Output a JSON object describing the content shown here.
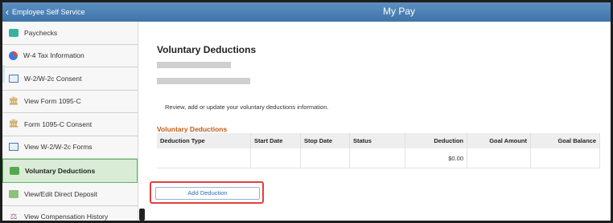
{
  "header": {
    "back_label": "Employee Self Service",
    "title": "My Pay"
  },
  "sidebar": {
    "items": [
      {
        "label": "Paychecks",
        "icon": "paychecks-icon"
      },
      {
        "label": "W-4 Tax Information",
        "icon": "w4-tax-icon"
      },
      {
        "label": "W-2/W-2c Consent",
        "icon": "form-icon"
      },
      {
        "label": "View Form 1095-C",
        "icon": "bank-icon"
      },
      {
        "label": "Form 1095-C Consent",
        "icon": "bank-icon"
      },
      {
        "label": "View W-2/W-2c Forms",
        "icon": "form-icon"
      },
      {
        "label": "Voluntary Deductions",
        "icon": "voluntary-deductions-icon",
        "active": true
      },
      {
        "label": "View/Edit Direct Deposit",
        "icon": "direct-deposit-icon"
      },
      {
        "label": "View Compensation History",
        "icon": "compensation-history-icon"
      }
    ]
  },
  "main": {
    "title": "Voluntary Deductions",
    "intro": "Review, add or update your voluntary deductions information.",
    "grid_title": "Voluntary Deductions",
    "columns": [
      "Deduction Type",
      "Start Date",
      "Stop Date",
      "Status",
      "Deduction",
      "Goal Amount",
      "Goal Balance"
    ],
    "rows": [
      [
        "",
        "",
        "",
        "",
        "$0.00",
        "",
        ""
      ]
    ],
    "add_button": "Add Deduction"
  },
  "colors": {
    "header_bar": "#4a80b6",
    "active_item_bg": "#d9ecd6",
    "grid_title": "#c05a12",
    "highlight": "#e0403b"
  }
}
